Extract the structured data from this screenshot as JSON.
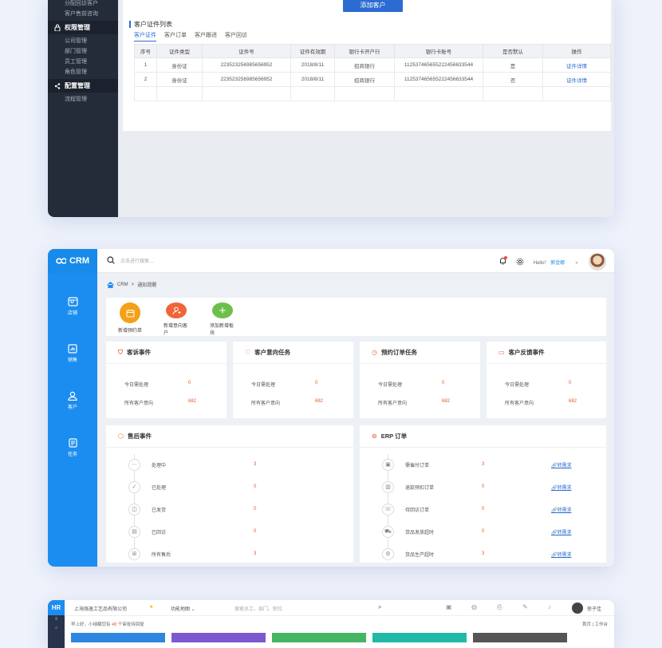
{
  "crm_admin": {
    "sidebar": {
      "top_items": [
        "分配回访客户",
        "客户售前咨询"
      ],
      "groups": [
        {
          "title": "权限管理",
          "icon": "lock-icon",
          "items": [
            "公司管理",
            "部门管理",
            "员工管理",
            "角色管理"
          ]
        },
        {
          "title": "配置管理",
          "icon": "share-icon",
          "items": [
            "流程管理"
          ]
        }
      ]
    },
    "add_button": "添加客户",
    "panel_title": "客户证件列表",
    "tabs": [
      "客户证件",
      "客户订单",
      "客户跟进",
      "客户回访"
    ],
    "table": {
      "headers": [
        "序号",
        "证件类型",
        "证件号",
        "证件有效期",
        "银行卡开户行",
        "银行卡账号",
        "是否默认",
        "操作"
      ],
      "rows": [
        [
          "1",
          "身份证",
          "223523256985656952",
          "2018/8/11",
          "招商银行",
          "1125374656552224566335​44",
          "是",
          "证件详情"
        ],
        [
          "2",
          "身份证",
          "223523256985656952",
          "2018/8/11",
          "招商银行",
          "1125374656552224566335​44",
          "否",
          "证件详情"
        ]
      ]
    }
  },
  "crm_dashboard": {
    "logo": "CRM",
    "nav": [
      {
        "label": "店铺",
        "icon": "store-icon"
      },
      {
        "label": "销售",
        "icon": "sales-icon"
      },
      {
        "label": "客户",
        "icon": "customer-icon"
      },
      {
        "label": "任务",
        "icon": "task-icon"
      }
    ],
    "search_placeholder": "点击进行搜索....",
    "greeting": "Hello！",
    "username": "郭金娜",
    "breadcrumb": [
      "CRM",
      "通知提醒"
    ],
    "quick_actions": [
      {
        "label": "新增预约单",
        "color": "#f4a018",
        "icon": "calendar-icon"
      },
      {
        "label": "新增意向客户",
        "color": "#ef6538",
        "icon": "user-add-icon"
      },
      {
        "label": "添加新增板块",
        "color": "#6cc04a",
        "icon": "plus-icon"
      }
    ],
    "summary_boxes": [
      {
        "title": "客诉事件",
        "icon": "shield-icon",
        "rows": [
          {
            "k": "今日需处理",
            "v": "0"
          },
          {
            "k": "所有客户意向",
            "v": "682"
          }
        ]
      },
      {
        "title": "客户意向任务",
        "icon": "heart-icon",
        "rows": [
          {
            "k": "今日需处理",
            "v": "0"
          },
          {
            "k": "所有客户意向",
            "v": "682"
          }
        ]
      },
      {
        "title": "预约订单任务",
        "icon": "clock-icon",
        "rows": [
          {
            "k": "今日需处理",
            "v": "0"
          },
          {
            "k": "所有客户意向",
            "v": "682"
          }
        ]
      },
      {
        "title": "客户反馈事件",
        "icon": "message-icon",
        "rows": [
          {
            "k": "今日需处理",
            "v": "0"
          },
          {
            "k": "所有客户意向",
            "v": "682"
          }
        ]
      }
    ],
    "after_sales": {
      "title": "售后事件",
      "rows": [
        {
          "label": "处理中",
          "value": "3",
          "icon": "more-icon"
        },
        {
          "label": "已处理",
          "value": "0",
          "icon": "check-icon"
        },
        {
          "label": "已发货",
          "value": "0",
          "icon": "box-icon"
        },
        {
          "label": "已回访",
          "value": "0",
          "icon": "chat-icon"
        },
        {
          "label": "所有售后",
          "value": "3",
          "icon": "grid-icon"
        }
      ]
    },
    "erp": {
      "title": "ERP 订单",
      "link_label": "转需求",
      "rows": [
        {
          "label": "需催付订单",
          "value": "3",
          "icon": "wallet-icon"
        },
        {
          "label": "退款预扣订单",
          "value": "0",
          "icon": "refund-icon"
        },
        {
          "label": "待回访订单",
          "value": "0",
          "icon": "phone-icon"
        },
        {
          "label": "货品发放超时",
          "value": "0",
          "icon": "truck-icon"
        },
        {
          "label": "货品生产超时",
          "value": "3",
          "icon": "factory-icon"
        }
      ]
    }
  },
  "hr": {
    "logo": "HR",
    "company": "上海强逸工艺品有限公司",
    "menu": "功能地图",
    "search_placeholder": "搜索员工、部门、职位",
    "user": "徐子佳",
    "notice_prefix": "早上好，小绿藏您有",
    "notice_count": "48",
    "notice_suffix": "个审批待回复",
    "crumb": [
      "首页",
      "工作台"
    ],
    "tile_colors": [
      "#2f86e0",
      "#7b58d0",
      "#45b563",
      "#22b8a8",
      "#555"
    ]
  }
}
